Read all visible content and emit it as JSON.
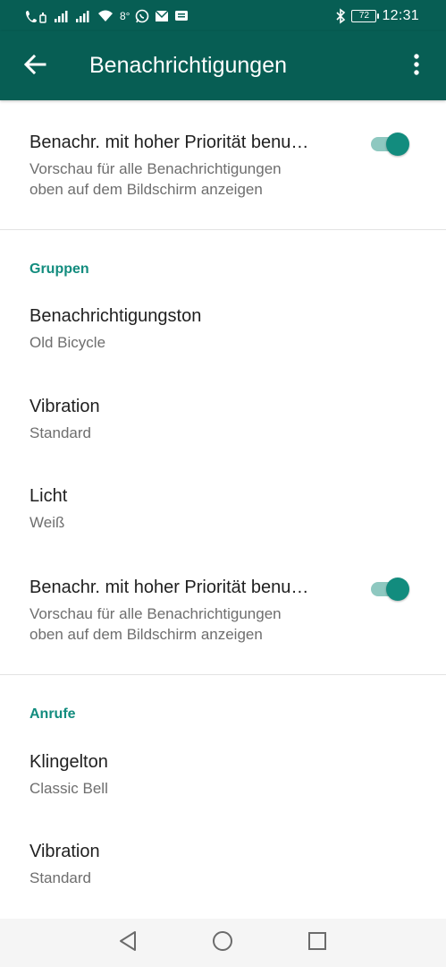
{
  "status_bar": {
    "temperature": "8°",
    "battery_level": "72",
    "clock": "12:31"
  },
  "app_bar": {
    "title": "Benachrichtigungen"
  },
  "top_setting": {
    "title": "Benachr. mit hoher Priorität benu…",
    "subtitle_line1": "Vorschau für alle Benachrichtigungen",
    "subtitle_line2": "oben auf dem Bildschirm anzeigen",
    "enabled": true
  },
  "groups": {
    "header": "Gruppen",
    "tone": {
      "title": "Benachrichtigungston",
      "value": "Old Bicycle"
    },
    "vibration": {
      "title": "Vibration",
      "value": "Standard"
    },
    "light": {
      "title": "Licht",
      "value": "Weiß"
    },
    "priority": {
      "title": "Benachr. mit hoher Priorität benu…",
      "subtitle_line1": "Vorschau für alle Benachrichtigungen",
      "subtitle_line2": "oben auf dem Bildschirm anzeigen",
      "enabled": true
    }
  },
  "calls": {
    "header": "Anrufe",
    "ringtone": {
      "title": "Klingelton",
      "value": "Classic Bell"
    },
    "vibration": {
      "title": "Vibration",
      "value": "Standard"
    }
  },
  "colors": {
    "app_bar": "#075e54",
    "accent": "#128c7e",
    "toggle_track": "#8ec8c0"
  },
  "icons": {
    "back": "arrow-left-icon",
    "more": "more-vertical-icon",
    "nav_back": "triangle-back-icon",
    "nav_home": "circle-home-icon",
    "nav_recents": "square-recents-icon"
  }
}
